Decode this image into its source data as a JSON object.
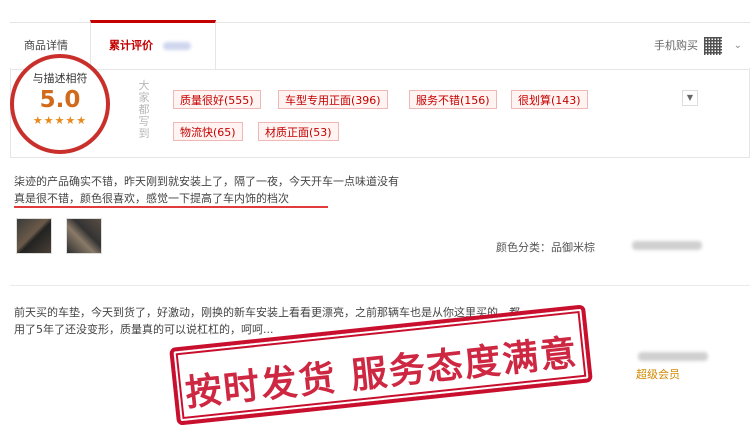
{
  "tabs": {
    "description": "商品详情",
    "reviews": "累计评价",
    "mobile_buy": "手机购买",
    "caret": "⌄"
  },
  "rating": {
    "title": "与描述相符",
    "score": "5.0",
    "stars": "★★★★★"
  },
  "impression_label": "大家都写到",
  "tags": [
    {
      "label": "质量很好(555)"
    },
    {
      "label": "车型专用正面(396)"
    },
    {
      "label": "服务不错(156)"
    },
    {
      "label": "很划算(143)"
    },
    {
      "label": "物流快(65)"
    },
    {
      "label": "材质正面(53)"
    }
  ],
  "reviews": [
    {
      "line1": "柒迹的产品确实不错，昨天刚到就安装上了，隔了一夜，今天开车一点味道没有",
      "line2": "真是很不错，颜色很喜欢，感觉一下提高了车内饰的档次",
      "sku": "颜色分类：品御米棕"
    },
    {
      "line1": "前天买的车垫，今天到货了，好激动，刚换的新车安装上看看更漂亮，之前那辆车也是从你这里买的，都",
      "line2": "用了5年了还没变形，质量真的可以说杠杠的，呵呵...",
      "member": "超级会员"
    }
  ],
  "stamp": "按时发货 服务态度满意",
  "colors": {
    "accent": "#c40000",
    "stamp": "#c8102e",
    "score": "#d26a1c"
  }
}
